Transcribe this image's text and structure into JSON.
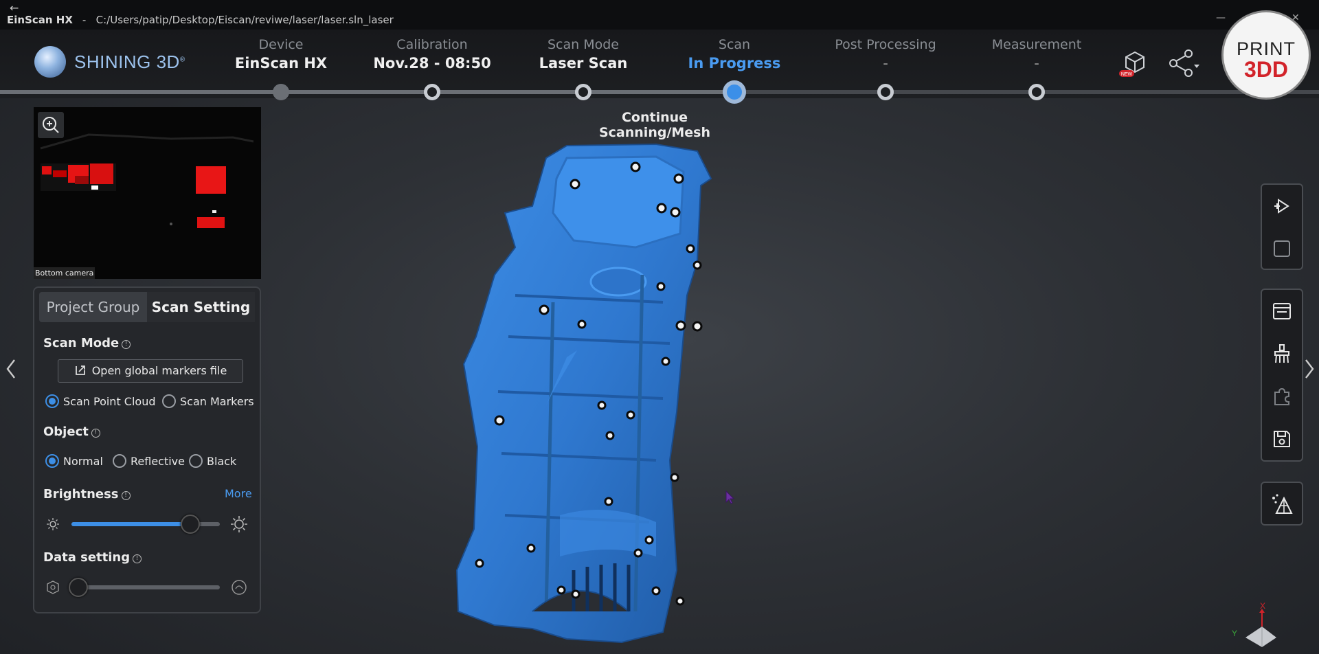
{
  "window": {
    "app_name": "EinScan HX",
    "separator": "-",
    "path": "C:/Users/patip/Desktop/Eiscan/reviwe/laser/laser.sln_laser",
    "minimize": "—",
    "close": "✕"
  },
  "brand": {
    "name": "SHINING 3D",
    "mark": "®"
  },
  "workflow_steps": [
    {
      "label": "Device",
      "value": "EinScan HX"
    },
    {
      "label": "Calibration",
      "value": "Nov.28 - 08:50"
    },
    {
      "label": "Scan Mode",
      "value": "Laser Scan"
    },
    {
      "label": "Scan",
      "value": "In Progress"
    },
    {
      "label": "Post Processing",
      "value": "-"
    },
    {
      "label": "Measurement",
      "value": "-"
    }
  ],
  "status_message": "Continue Scanning/Mesh",
  "header_icons": [
    "3d-model-new-icon",
    "share-icon"
  ],
  "new_badge": "NEW",
  "watermark": {
    "line1": "PRINT",
    "line2": "3DD"
  },
  "camera": {
    "caption": "Bottom camera"
  },
  "panel": {
    "tabs": [
      "Project Group",
      "Scan Setting"
    ],
    "scan_mode": {
      "title": "Scan Mode",
      "open_button": "Open global markers file",
      "options": [
        "Scan Point Cloud",
        "Scan Markers"
      ],
      "selected": "Scan Point Cloud"
    },
    "object": {
      "title": "Object",
      "options": [
        "Normal",
        "Reflective",
        "Black"
      ],
      "selected": "Normal"
    },
    "brightness": {
      "title": "Brightness",
      "more": "More",
      "level_fraction": 0.8
    },
    "data_setting": {
      "title": "Data setting",
      "level_fraction": 0.0
    }
  },
  "right_toolbar": {
    "group1": [
      "scan-play-icon",
      "stop-icon"
    ],
    "group2": [
      "window-icon",
      "clean-brush-icon",
      "puzzle-icon",
      "save-icon"
    ],
    "group3": [
      "mesh-icon"
    ]
  },
  "axis": {
    "x": "X",
    "y": "Y"
  },
  "colors": {
    "accent": "#3d8fe6",
    "scan_model": "#2f78cf",
    "watermark_red": "#d2232a"
  }
}
